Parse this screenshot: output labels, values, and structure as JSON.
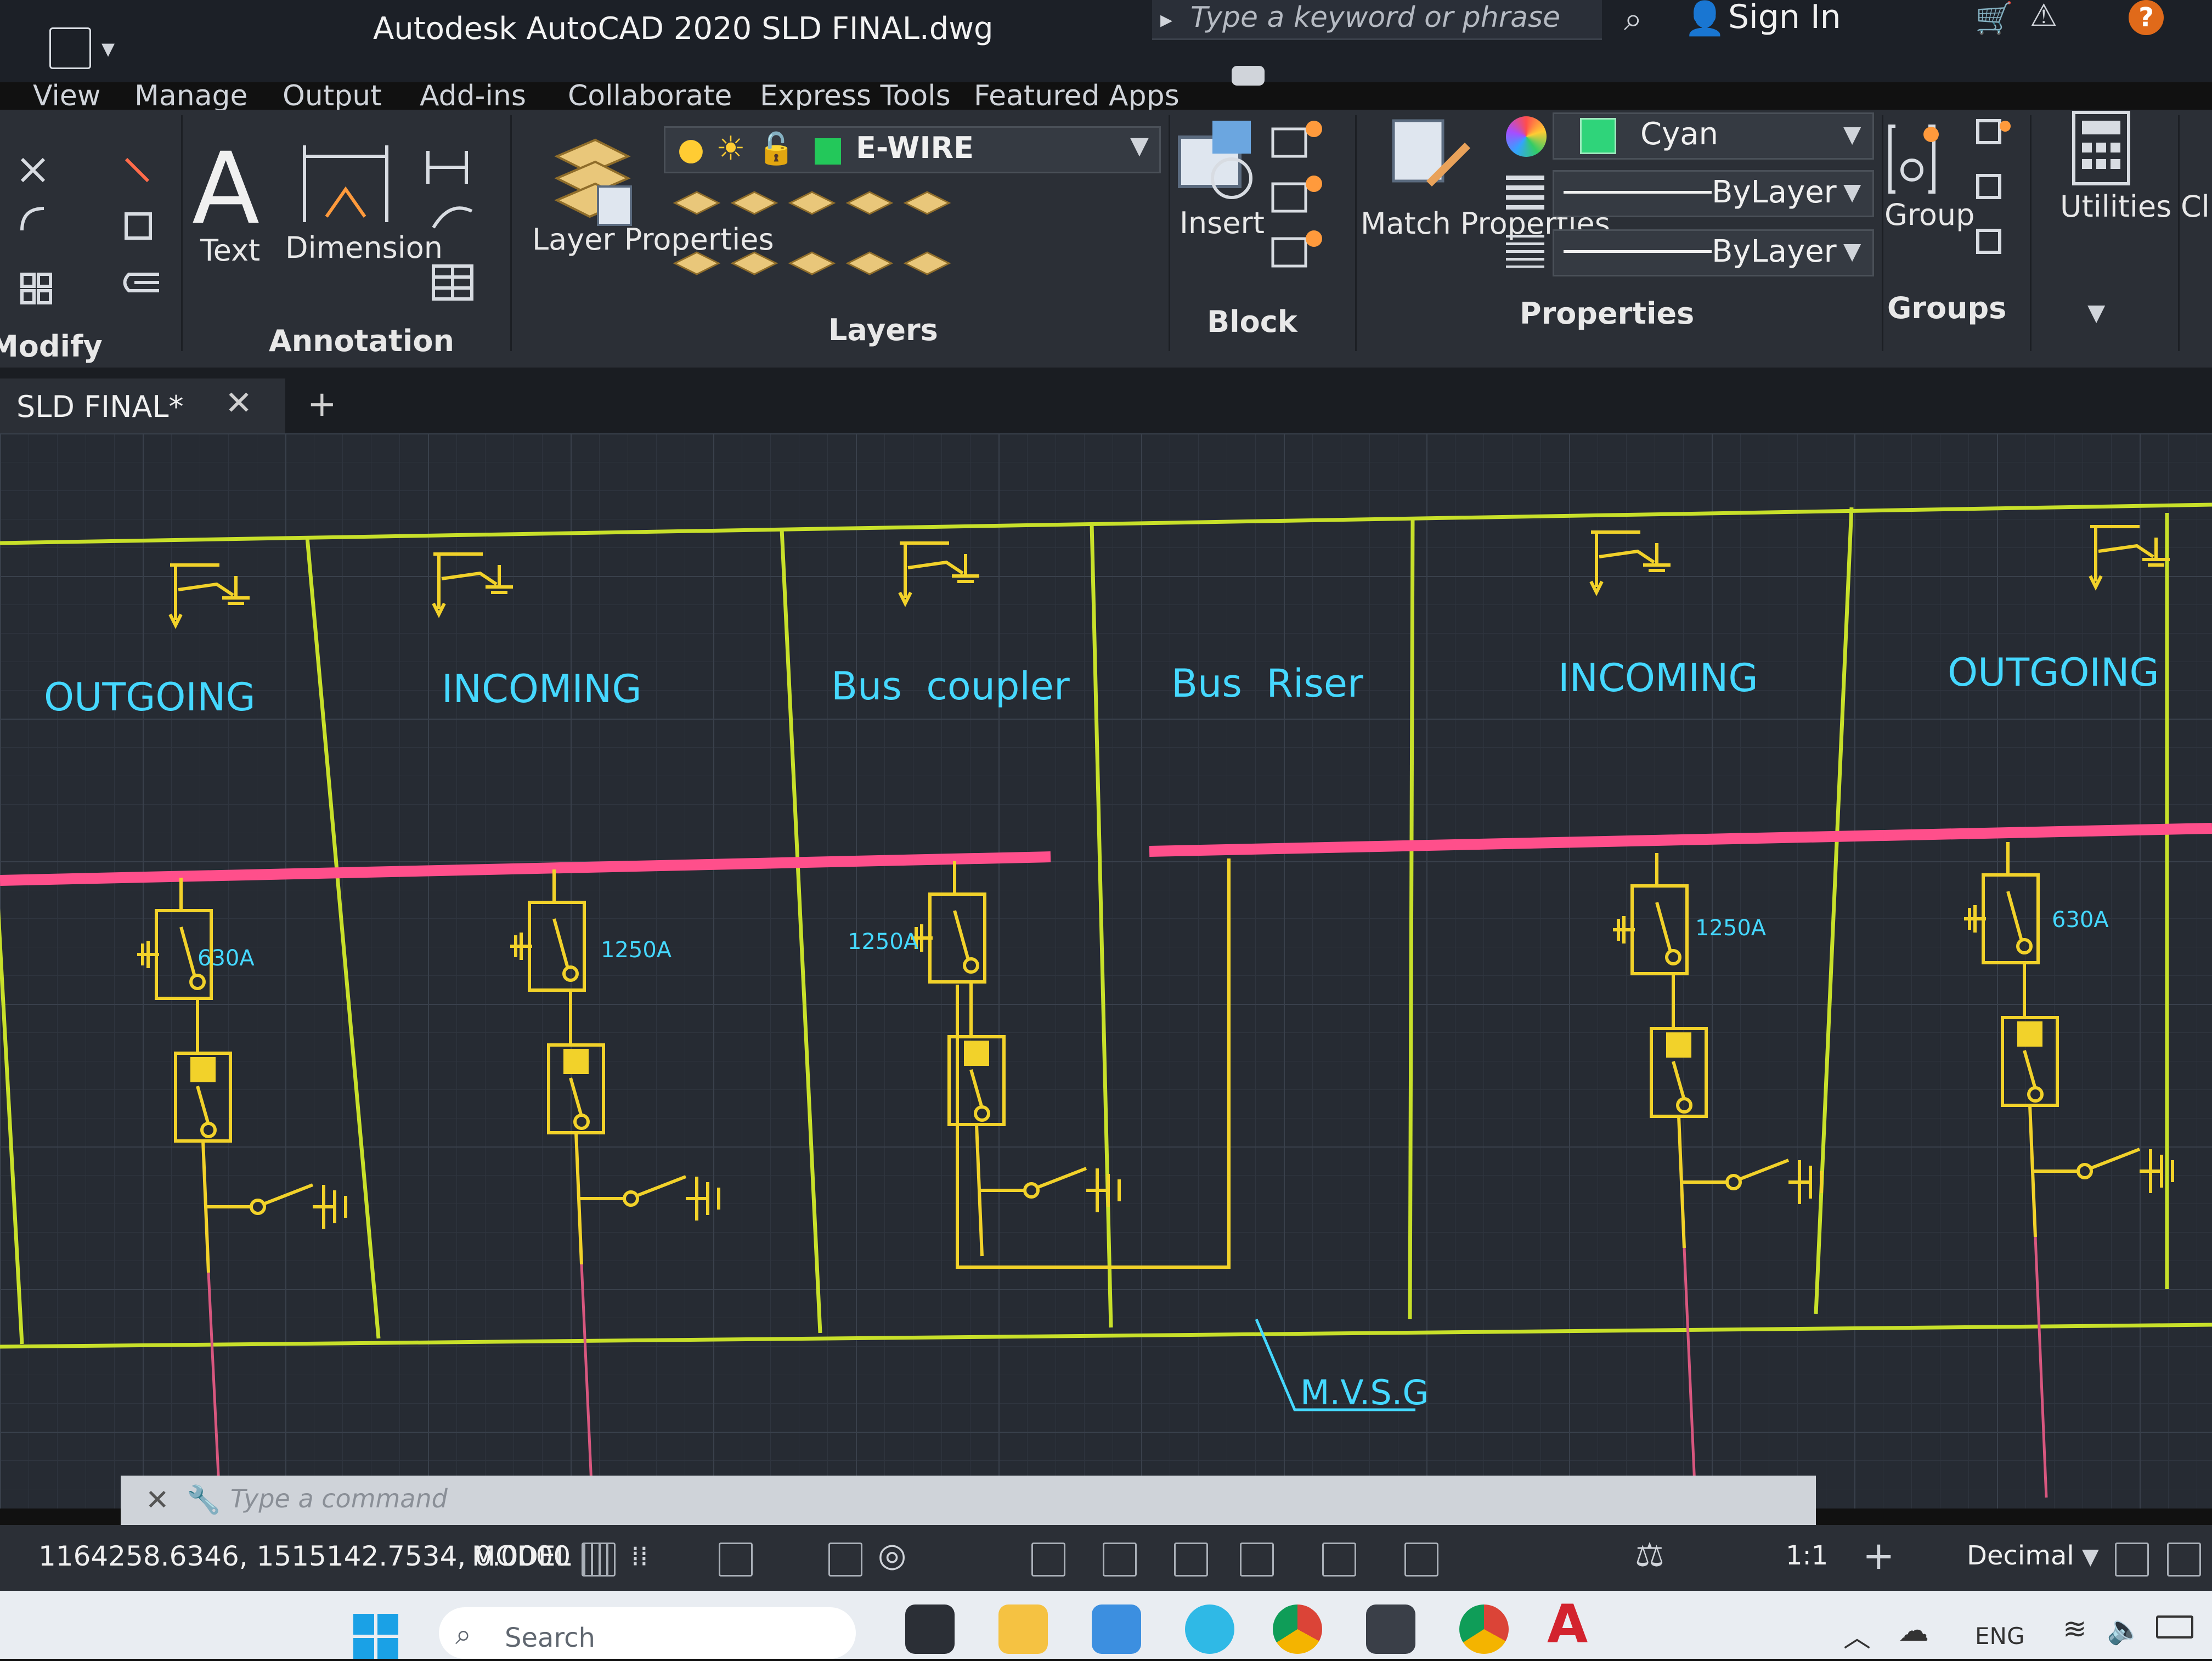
{
  "title_bar": {
    "title": "Autodesk AutoCAD 2020   SLD FINAL.dwg",
    "search_placeholder": "Type a keyword or phrase",
    "sign_in": "Sign In",
    "help": "?"
  },
  "ribbon_tabs": [
    "View",
    "Manage",
    "Output",
    "Add-ins",
    "Collaborate",
    "Express Tools",
    "Featured Apps"
  ],
  "ribbon": {
    "modify_title": "Modify",
    "text_label": "Text",
    "dimension_label": "Dimension",
    "annotation_title": "Annotation",
    "layer_properties_label": "Layer Properties",
    "current_layer": "E-WIRE",
    "layers_title": "Layers",
    "insert_label": "Insert",
    "block_title": "Block",
    "match_properties_label": "Match Properties",
    "color_value": "Cyan",
    "linetype_value": "ByLayer",
    "lineweight_value": "ByLayer",
    "properties_title": "Properties",
    "group_label": "Group",
    "groups_title": "Groups",
    "utilities_label": "Utilities",
    "clipboard_label": "Cli"
  },
  "document_tab": {
    "label": "SLD FINAL*",
    "close": "✕",
    "new_tab": "+"
  },
  "drawing": {
    "panels": [
      {
        "label": "OUTGOING",
        "rating": "630A"
      },
      {
        "label": "INCOMING",
        "rating": "1250A"
      },
      {
        "label": "Bus  coupler",
        "rating": "1250A"
      },
      {
        "label": "Bus  Riser",
        "rating": ""
      },
      {
        "label": "INCOMING",
        "rating": "1250A"
      },
      {
        "label": "OUTGOING",
        "rating": "630A"
      }
    ],
    "switchgear_label": "M.V.S.G",
    "colors": {
      "frame": "#c8e02a",
      "busbar": "#ff4f8b",
      "symbol": "#f2d22a",
      "text": "#45d8ff",
      "cable": "#d8577f"
    }
  },
  "command_line": {
    "placeholder": "Type a command",
    "close": "✕"
  },
  "status_bar": {
    "coordinates": "1164258.6346, 1515142.7534, 0.0000",
    "space": "MODEL",
    "scale": "1:1",
    "units": "Decimal"
  },
  "taskbar": {
    "search_label": "Search",
    "language": "ENG"
  }
}
